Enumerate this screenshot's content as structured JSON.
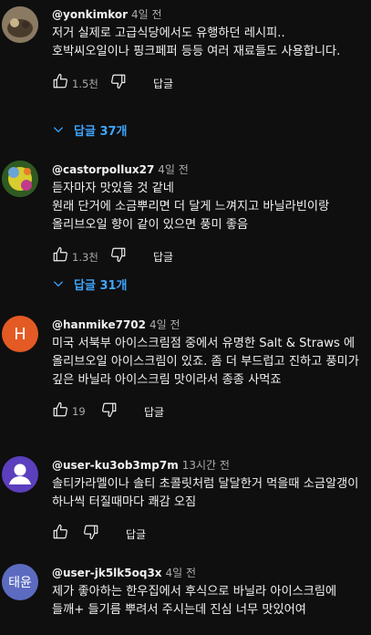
{
  "comments": [
    {
      "handle": "@yonkimkor",
      "time": "4일 전",
      "text": "저거 실제로 고급식당에서도 유행하던 레시피.. 호박씨오일이나 핑크페퍼 등등 여러 재료들도 사용합니다.",
      "likes": "1.5천",
      "reply_label": "답글",
      "replies_label": "답글 37개"
    },
    {
      "handle": "@castorpollux27",
      "time": "4일 전",
      "text": "듣자마자 맛있을 것 같네\n원래 단거에 소금뿌리면 더 달게 느껴지고 바닐라빈이랑 올리브오일 향이 같이 있으면 풍미 좋음",
      "likes": "1.3천",
      "reply_label": "답글",
      "replies_label": "답글 31개"
    },
    {
      "handle": "@hanmike7702",
      "time": "4일 전",
      "avatar_letter": "H",
      "avatar_color": "#e35a24",
      "text": "미국 서북부 아이스크림점 중에서 유명한 Salt & Straws 에 올리브오일 아이스크림이 있죠. 좀 더 부드럽고 진하고 풍미가 깊은 바닐라 아이스크림 맛이라서 종종 사먹죠",
      "likes": "19",
      "reply_label": "답글"
    },
    {
      "handle": "@user-ku3ob3mp7m",
      "time": "13시간 전",
      "avatar_color": "#5b3fbd",
      "text": "솔티카라멜이나 솔티 초콜릿처럼 달달한거 먹을때 소금알갱이 하나씩 터질때마다 쾌감 오짐",
      "likes": "",
      "reply_label": "답글"
    },
    {
      "handle": "@user-jk5lk5oq3x",
      "time": "4일 전",
      "avatar_letter": "태윤",
      "avatar_color": "#5c6bc0",
      "text": "제가 좋아하는 한우집에서 후식으로 바닐라 아이스크림에 들깨+ 들기름 뿌려서 주시는데 진심 너무 맛있어여"
    }
  ]
}
